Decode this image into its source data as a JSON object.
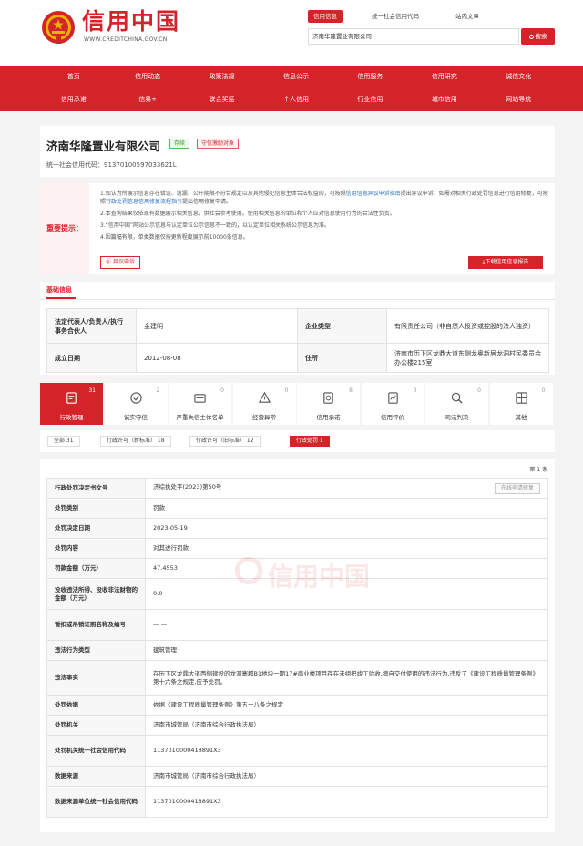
{
  "header": {
    "logo_text": "信用中国",
    "logo_url": "WWW.CREDITCHINA.GOV.CN",
    "search_tabs": [
      "信用信息",
      "统一社会信用代码",
      "站内文章"
    ],
    "search_value": "济南华隆置业有限公司",
    "search_button": "搜索"
  },
  "nav": {
    "row1": [
      "首页",
      "信用动态",
      "政策法规",
      "信息公示",
      "信用服务",
      "信用研究",
      "诚信文化"
    ],
    "row2": [
      "信用承诺",
      "信易+",
      "联合奖惩",
      "个人信用",
      "行业信用",
      "城市信用",
      "网站导航"
    ]
  },
  "company": {
    "name": "济南华隆置业有限公司",
    "status_tag": "存续",
    "incentive_tag": "守信激励对象",
    "credit_code_label": "统一社会信用代码：",
    "credit_code": "91370100597033621L"
  },
  "notice": {
    "label": "重要提示：",
    "line1_a": "1.如认为所展示信息存在错误、遗漏，公开期限不符合规定以及其他侵犯信息主体合法权益的，可按照",
    "line1_link1": "信用信息异议申诉指南",
    "line1_b": "提出异议申诉；如需对相关行政处罚信息进行信用修复，可按照",
    "line1_link2": "行政处罚信息信用修复流程指引",
    "line1_c": "提出信用修复申请。",
    "line2": "2.本查询结果仅依现有数据展示相关信息，供社会参考使用。使用相关信息的单位和个人应对信息使用行为的合法性负责。",
    "line3": "3.“信用中国”网站公示信息与认定单位公示信息不一致的，以认定单位相关系统公示信息为准。",
    "line4": "4.因篇幅有限，单类数据仅按更新程度展示前10000条信息。",
    "objection_btn": "异议申诉",
    "download_btn": "下载信用信息报告"
  },
  "basic": {
    "title": "基础信息",
    "rep_label": "法定代表人/负责人/执行事务合伙人",
    "rep_value": "金建明",
    "type_label": "企业类型",
    "type_value": "有限责任公司（非自然人投资或控股的法人独资）",
    "date_label": "成立日期",
    "date_value": "2012-08-08",
    "addr_label": "住所",
    "addr_value": "济南市历下区龙鼎大道东侧龙奥新居龙洞村民委员会办公楼215室"
  },
  "record_tabs": [
    {
      "label": "行政管理",
      "count": "31",
      "icon": "admin-management-icon"
    },
    {
      "label": "诚实守信",
      "count": "2",
      "icon": "honesty-icon"
    },
    {
      "label": "严重失信主体名单",
      "count": "0",
      "icon": "blacklist-icon"
    },
    {
      "label": "经营异常",
      "count": "0",
      "icon": "abnormal-alert-icon"
    },
    {
      "label": "信用承诺",
      "count": "8",
      "icon": "commitment-icon"
    },
    {
      "label": "信用评价",
      "count": "0",
      "icon": "evaluation-icon"
    },
    {
      "label": "司法判决",
      "count": "0",
      "icon": "judgment-icon"
    },
    {
      "label": "其他",
      "count": "0",
      "icon": "other-icon"
    }
  ],
  "filters": [
    {
      "label": "全部  31"
    },
    {
      "label": "行政许可（新标准）  18"
    },
    {
      "label": "行政许可（旧标准）  12"
    },
    {
      "label": "行政处罚  1"
    }
  ],
  "detail": {
    "page_count": "第 1 条",
    "apply_btn": "在线申请修复",
    "rows": [
      {
        "k": "行政处罚决定书文号",
        "v": "济综执处字(2023)第50号"
      },
      {
        "k": "处罚类别",
        "v": "罚款"
      },
      {
        "k": "处罚决定日期",
        "v": "2023-05-19"
      },
      {
        "k": "处罚内容",
        "v": "对其进行罚款"
      },
      {
        "k": "罚款金额（万元）",
        "v": "47.4553"
      },
      {
        "k": "没收违法所得、没收非法财物的金额（万元）",
        "v": "0.0"
      },
      {
        "k": "暂扣或吊销证照名称及编号",
        "v": "— —"
      },
      {
        "k": "违法行为类型",
        "v": "建筑管理"
      },
      {
        "k": "违法事实",
        "v": "在历下区龙鼎大道西侧建设的龙洞寨郡B1地块一期17#商业楼项目存在未组织竣工验收,擅自交付使用的违法行为,违反了《建设工程质量管理条例》第十六条之规定,应予处罚。"
      },
      {
        "k": "处罚依据",
        "v": "依据《建设工程质量管理条例》第五十八条之规定"
      },
      {
        "k": "处罚机关",
        "v": "济南市城管局（济南市综合行政执法局）"
      },
      {
        "k": "处罚机关统一社会信用代码",
        "v": "113701000041889​1X3"
      },
      {
        "k": "数据来源",
        "v": "济南市城管局（济南市综合行政执法局）"
      },
      {
        "k": "数据来源单位统一社会信用代码",
        "v": "113701000041889​1X3"
      }
    ]
  },
  "watermark_text": "信用中国",
  "colors": {
    "brand": "#d5232a",
    "link": "#2a6bc4",
    "green": "#3a9a3a"
  }
}
